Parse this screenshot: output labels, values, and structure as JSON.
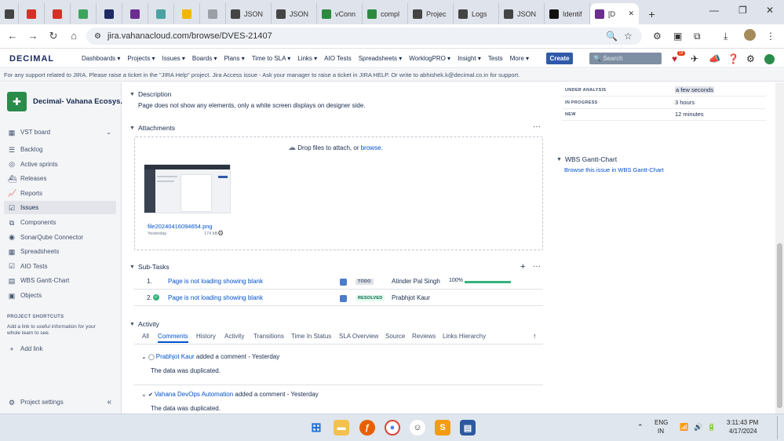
{
  "browser": {
    "tabs": [
      {
        "label": "",
        "icon": "chevron-down-icon",
        "color": "#444"
      },
      {
        "label": "",
        "icon": "gmail-icon",
        "color": "#d93025"
      },
      {
        "label": "",
        "icon": "gmail-icon",
        "color": "#d93025"
      },
      {
        "label": "",
        "icon": "green-app-icon",
        "color": "#3ba55d"
      },
      {
        "label": "",
        "icon": "d-app-icon",
        "color": "#1d2a63"
      },
      {
        "label": "",
        "icon": "decimal-icon",
        "color": "#6b2d8f"
      },
      {
        "label": "",
        "icon": "image-app-icon",
        "color": "#4aa3a2"
      },
      {
        "label": "",
        "icon": "yellow-app-icon",
        "color": "#f2b705"
      },
      {
        "label": "",
        "icon": "grey-circle-icon",
        "color": "#9aa0a6"
      },
      {
        "label": "JSON",
        "icon": "json-icon",
        "color": "#444"
      },
      {
        "label": "JSON",
        "icon": "json-icon",
        "color": "#444"
      },
      {
        "label": "vConn",
        "icon": "v-icon",
        "color": "#2b8a3e"
      },
      {
        "label": "compl",
        "icon": "v-icon",
        "color": "#2b8a3e"
      },
      {
        "label": "Projec",
        "icon": "v-icon",
        "color": "#444"
      },
      {
        "label": "Logs",
        "icon": "v-icon",
        "color": "#444"
      },
      {
        "label": "JSON",
        "icon": "json-icon",
        "color": "#444"
      },
      {
        "label": "Identif",
        "icon": "x-icon",
        "color": "#111"
      },
      {
        "label": "[D",
        "icon": "decimal-icon",
        "color": "#6b2d8f"
      }
    ],
    "new_tab": "+",
    "url": "jira.vahanacloud.com/browse/DVES-21407"
  },
  "jira": {
    "logo": "DECIMAL",
    "nav": [
      "Dashboards ▾",
      "Projects ▾",
      "Issues ▾",
      "Boards ▾",
      "Plans ▾",
      "Time to SLA ▾",
      "Links ▾",
      "AIO Tests",
      "Spreadsheets ▾",
      "WorklogPRO ▾",
      "Insight ▾",
      "Tests",
      "More ▾"
    ],
    "create": "Create",
    "search_placeholder": "Search",
    "notif_badge": "18"
  },
  "banner": "For any support related to JIRA. Please raise a ticket in the \"JIRA Help\" project. Jira Access issue - Ask your manager to raise a ticket in JIRA HELP. Or write to abhishek.k@decimal.co.in for support.",
  "sidebar": {
    "project_name": "Decimal- Vahana Ecosys...",
    "board": "VST board",
    "items": [
      {
        "label": "Backlog",
        "icon": "backlog-icon"
      },
      {
        "label": "Active sprints",
        "icon": "sprint-icon"
      },
      {
        "label": "Releases",
        "icon": "releases-icon"
      },
      {
        "label": "Reports",
        "icon": "reports-icon"
      },
      {
        "label": "Issues",
        "icon": "issues-icon"
      },
      {
        "label": "Components",
        "icon": "components-icon"
      },
      {
        "label": "SonarQube Connector",
        "icon": "sonarqube-icon"
      },
      {
        "label": "Spreadsheets",
        "icon": "spreadsheets-icon"
      },
      {
        "label": "AIO Tests",
        "icon": "aio-icon"
      },
      {
        "label": "WBS Gantt-Chart",
        "icon": "gantt-icon"
      },
      {
        "label": "Objects",
        "icon": "objects-icon"
      }
    ],
    "shortcuts_heading": "PROJECT SHORTCUTS",
    "shortcuts_text": "Add a link to useful information for your whole team to see.",
    "add_link": "Add link",
    "settings": "Project settings"
  },
  "description": {
    "heading": "Description",
    "text": "Page does not show any elements, only a white screen displays on designer side."
  },
  "attachments": {
    "heading": "Attachments",
    "drop_text": "Drop files to attach, or",
    "browse": "browse.",
    "file_name": "file20240416094654.png",
    "file_date": "Yesterday",
    "file_size": "174 kB"
  },
  "subtasks": {
    "heading": "Sub-Tasks",
    "rows": [
      {
        "num": "1.",
        "title": "Page is not loading showing blank",
        "status": "TODO",
        "assignee": "Atinder Pal Singh",
        "progress": "100%",
        "done": false
      },
      {
        "num": "2.",
        "title": "Page is not loading showing blank",
        "status": "RESOLVED",
        "assignee": "Prabhjot Kaur",
        "progress": "",
        "done": true
      }
    ]
  },
  "activity": {
    "heading": "Activity",
    "tabs": [
      "All",
      "Comments",
      "History",
      "Activity",
      "Transitions",
      "Time In Status",
      "SLA Overview",
      "Source",
      "Reviews",
      "Links Hierarchy"
    ],
    "selected": "Comments",
    "comments": [
      {
        "author": "Prabhjot Kaur",
        "action": "added a comment - Yesterday",
        "body": "The data was duplicated."
      },
      {
        "author": "Vahana DevOps Automation",
        "action": "added a comment - Yesterday",
        "body": "The data was duplicated."
      }
    ]
  },
  "right": {
    "status_rows": [
      {
        "key": "UNDER ANALYSIS",
        "value": "a few seconds"
      },
      {
        "key": "IN PROGRESS",
        "value": "3 hours"
      },
      {
        "key": "NEW",
        "value": "12 minutes"
      }
    ],
    "gantt_heading": "WBS Gantt-Chart",
    "gantt_link": "Browse this issue in WBS Gantt-Chart"
  },
  "taskbar": {
    "lang": "ENG",
    "lang2": "IN",
    "time": "3:11:43 PM",
    "date": "4/17/2024"
  },
  "colors": {
    "accent": "#0052cc",
    "create": "#2f5aa8",
    "progress": "#36b37e"
  }
}
